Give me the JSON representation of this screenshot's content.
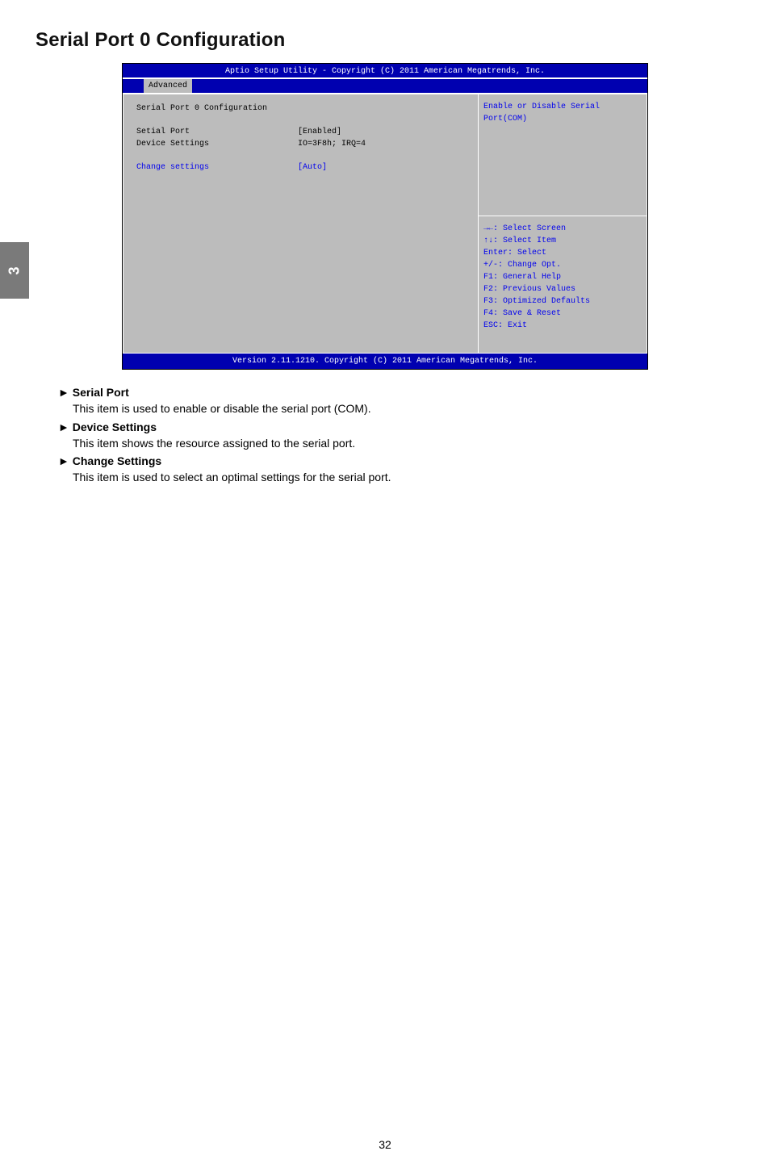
{
  "sidetab": "3",
  "page_title": "Serial Port 0 Configuration",
  "bios": {
    "header": "Aptio Setup Utility - Copyright (C) 2011 American Megatrends, Inc.",
    "tab": "Advanced",
    "section_title": "Serial Port 0 Configuration",
    "rows": [
      {
        "label": "Setial Port",
        "value": "[Enabled]",
        "highlight": false
      },
      {
        "label": "Device Settings",
        "value": "IO=3F8h; IRQ=4",
        "highlight": false
      }
    ],
    "rows2": [
      {
        "label": "Change settings",
        "value": "[Auto]",
        "highlight": true
      }
    ],
    "help_lines": [
      "Enable or Disable Serial",
      "Port(COM)"
    ],
    "key_lines": [
      "→←: Select Screen",
      "↑↓: Select Item",
      "Enter: Select",
      "+/-: Change Opt.",
      "F1: General Help",
      "F2: Previous Values",
      "F3: Optimized Defaults",
      "F4: Save & Reset",
      "ESC: Exit"
    ],
    "footer": "Version 2.11.1210. Copyright (C) 2011 American Megatrends, Inc."
  },
  "desc": [
    {
      "head": "► Serial Port",
      "body": "This item is used to enable or disable the serial port (COM)."
    },
    {
      "head": "► Device Settings",
      "body": "This item shows the resource assigned to the serial port."
    },
    {
      "head": "► Change Settings",
      "body": "This item is used to select an optimal settings for the serial port."
    }
  ],
  "page_number": "32"
}
